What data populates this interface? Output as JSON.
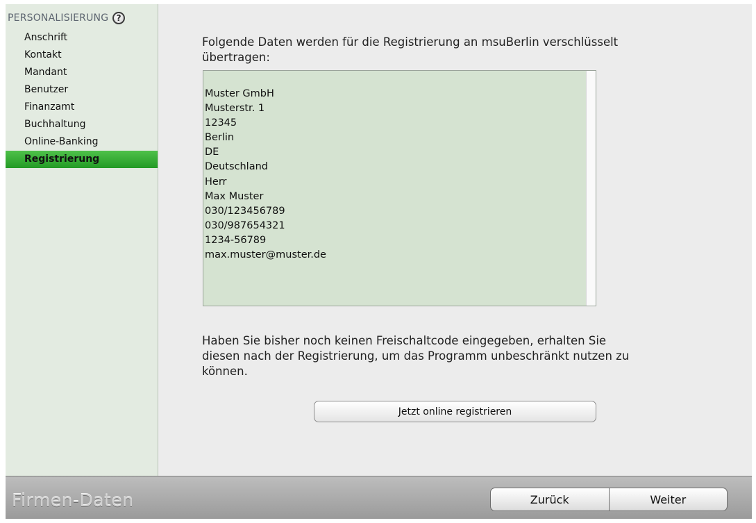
{
  "sidebar": {
    "heading": "PERSONALISIERUNG",
    "help_icon": "?",
    "items": [
      {
        "label": "Anschrift",
        "active": false
      },
      {
        "label": "Kontakt",
        "active": false
      },
      {
        "label": "Mandant",
        "active": false
      },
      {
        "label": "Benutzer",
        "active": false
      },
      {
        "label": "Finanzamt",
        "active": false
      },
      {
        "label": "Buchhaltung",
        "active": false
      },
      {
        "label": "Online-Banking",
        "active": false
      },
      {
        "label": "Registrierung",
        "active": true
      }
    ]
  },
  "main": {
    "intro": "Folgende Daten werden für die Registrierung an msuBerlin verschlüsselt übertragen:",
    "data_lines": [
      "Muster GmbH",
      "Musterstr. 1",
      "12345",
      "Berlin",
      "DE",
      "Deutschland",
      "Herr",
      "Max Muster",
      "030/123456789",
      "030/987654321",
      "1234-56789",
      "max.muster@muster.de"
    ],
    "info": "Haben Sie bisher noch keinen Freischaltcode eingegeben, erhalten Sie diesen nach der Registrierung, um das Programm unbeschränkt nutzen zu können.",
    "register_button": "Jetzt online registrieren"
  },
  "footer": {
    "title": "Firmen-Daten",
    "back_button": "Zurück",
    "next_button": "Weiter"
  },
  "colors": {
    "active_item": "#3bb23a",
    "data_box": "#d5e3d1",
    "sidebar": "#e3ebe1"
  }
}
